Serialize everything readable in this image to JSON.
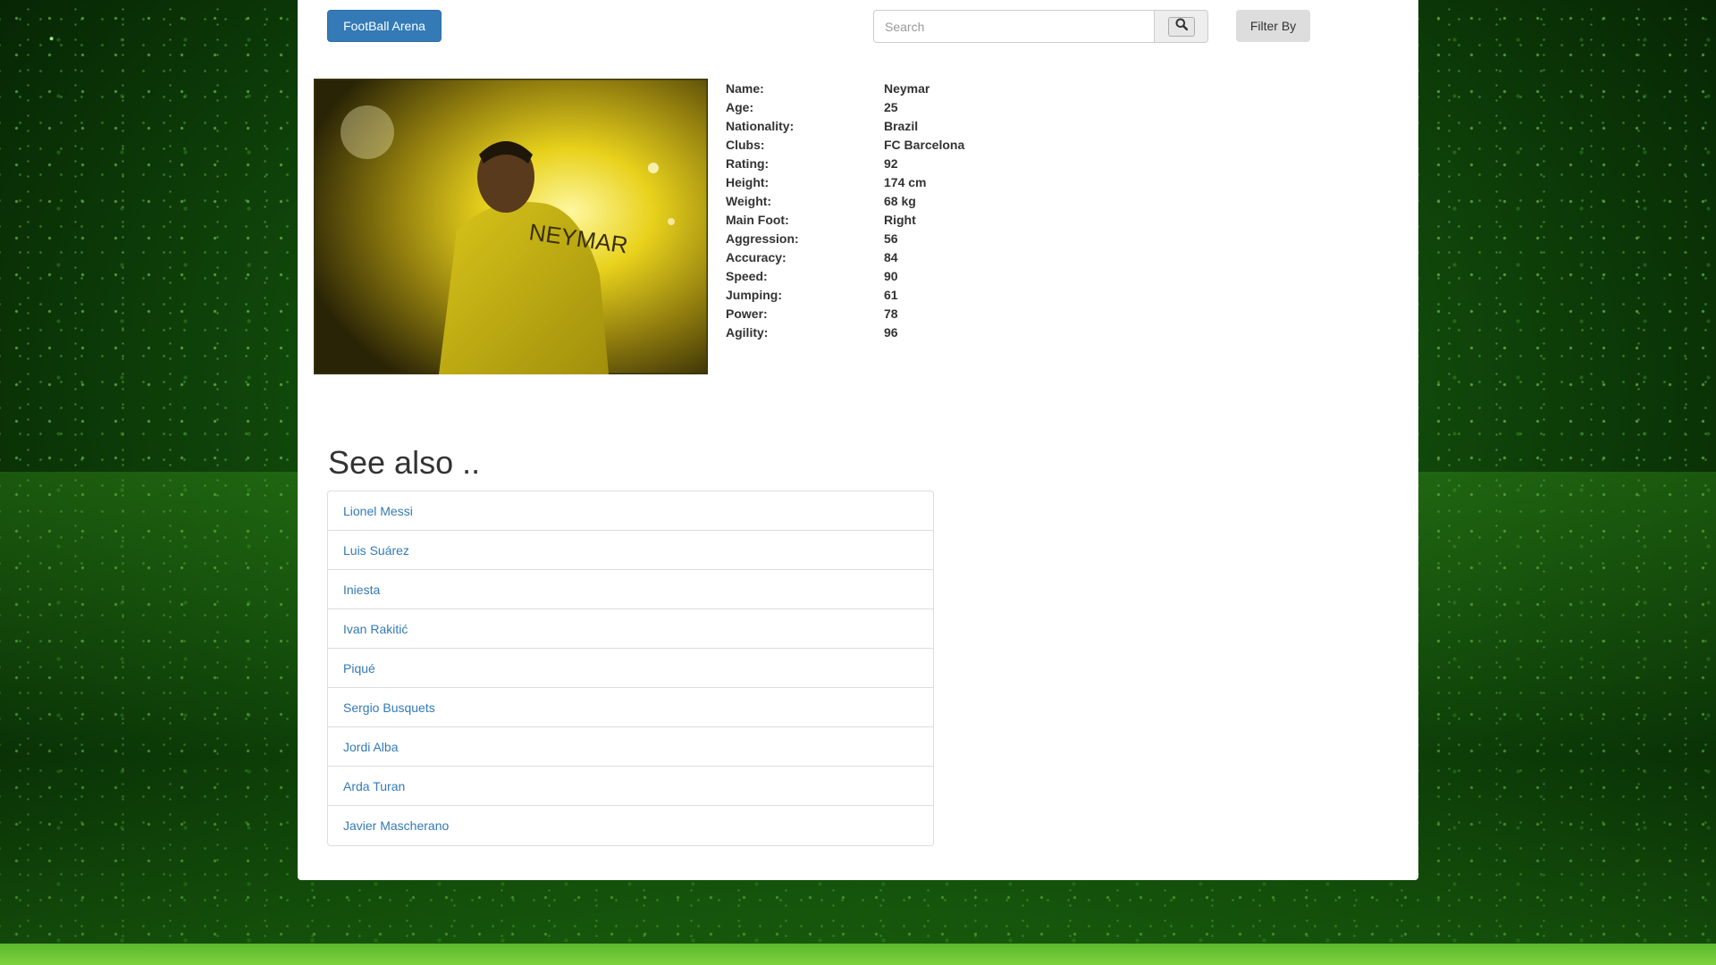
{
  "header": {
    "brand_label": "FootBall Arena",
    "search_placeholder": "Search",
    "search_icon": "search-icon",
    "filter_label": "Filter By"
  },
  "player": {
    "image_alt": "Neymar",
    "jersey_text": "NEYMAR",
    "details": [
      {
        "label": "Name:",
        "value": "Neymar"
      },
      {
        "label": "Age:",
        "value": "25"
      },
      {
        "label": "Nationality:",
        "value": "Brazil"
      },
      {
        "label": "Clubs:",
        "value": "FC Barcelona"
      },
      {
        "label": "Rating:",
        "value": "92"
      },
      {
        "label": "Height:",
        "value": "174 cm"
      },
      {
        "label": "Weight:",
        "value": "68 kg"
      },
      {
        "label": "Main Foot:",
        "value": "Right"
      },
      {
        "label": "Aggression:",
        "value": "56"
      },
      {
        "label": "Accuracy:",
        "value": "84"
      },
      {
        "label": "Speed:",
        "value": "90"
      },
      {
        "label": "Jumping:",
        "value": "61"
      },
      {
        "label": "Power:",
        "value": "78"
      },
      {
        "label": "Agility:",
        "value": "96"
      }
    ]
  },
  "see_also": {
    "title": "See also ..",
    "items": [
      "Lionel Messi",
      "Luis Suárez",
      "Iniesta",
      "Ivan Rakitić",
      "Piqué",
      "Sergio Busquets",
      "Jordi Alba",
      "Arda Turan",
      "Javier Mascherano"
    ]
  },
  "colors": {
    "primary": "#337ab7",
    "background_green": "#14520d",
    "panel": "#ffffff"
  }
}
